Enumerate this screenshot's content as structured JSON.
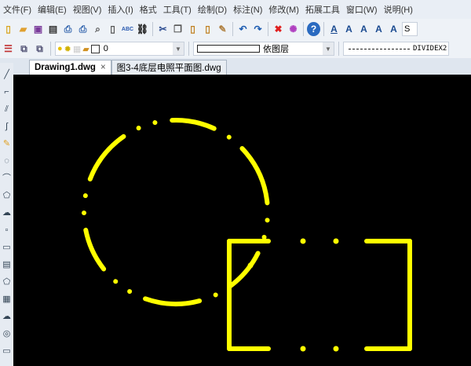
{
  "menu": [
    "文件(F)",
    "编辑(E)",
    "视图(V)",
    "插入(I)",
    "格式",
    "工具(T)",
    "绘制(D)",
    "标注(N)",
    "修改(M)",
    "拓展工具",
    "窗口(W)",
    "说明(H)"
  ],
  "toolbar": {
    "icons": [
      "new-icon",
      "open-icon",
      "save-icon",
      "print-preview-icon",
      "plot-icon",
      "print-icon",
      "preview-icon",
      "publish-icon",
      "spellcheck-icon",
      "find-icon",
      "cut-icon",
      "copy-icon",
      "paste-icon",
      "paste-special-icon",
      "match-properties-icon",
      "undo-icon",
      "redo-icon",
      "delete-icon",
      "select-icon",
      "help-icon",
      "text-style-icon",
      "text-icon",
      "edit-text-icon",
      "text-pen-icon",
      "find-text-icon"
    ],
    "style_combo": "S"
  },
  "layer": {
    "current": "0",
    "color_label": "依图层",
    "linetype": "DIVIDEX2"
  },
  "tabs": [
    {
      "label": "Drawing1.dwg",
      "close": "×",
      "active": true
    },
    {
      "label": "图3-4底层电照平面图.dwg",
      "active": false
    }
  ],
  "drawing": {
    "color": "#ffff00",
    "background": "#000000"
  }
}
